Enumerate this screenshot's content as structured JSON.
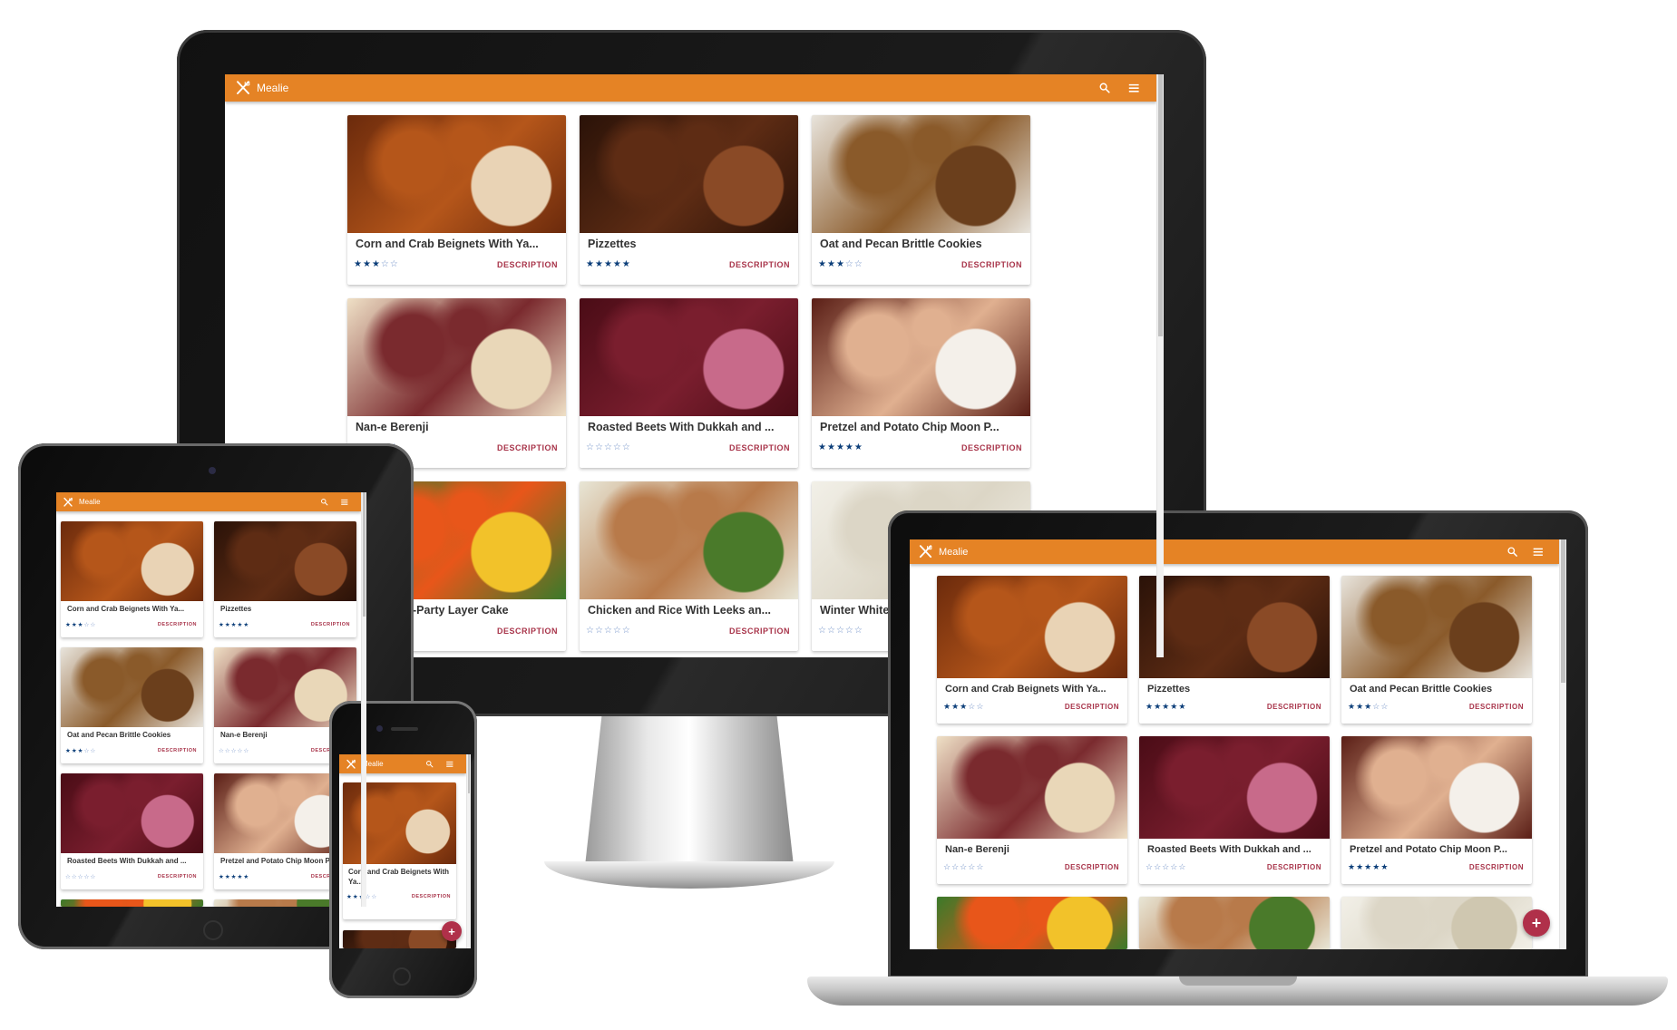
{
  "app": {
    "title": "Mealie",
    "icons": {
      "logo": "fork-knife-icon",
      "search": "search-icon",
      "menu": "hamburger-menu-icon",
      "add": "plus-icon"
    },
    "fab_label": "+",
    "colors": {
      "appbar": "#E58325",
      "description": "#a8344a",
      "star_filled": "#0d3f7a",
      "star_empty": "#6d8ec6",
      "fab": "#b0304a"
    }
  },
  "card_action_label": "DESCRIPTION",
  "recipes": [
    {
      "name": "Corn and Crab Beignets With Ya...",
      "rating": 3,
      "image_colors": [
        "#6b2a0c",
        "#b5561a",
        "#e9d3b5"
      ]
    },
    {
      "name": "Pizzettes",
      "rating": 5,
      "image_colors": [
        "#2a1208",
        "#5e2c14",
        "#8a4a26"
      ]
    },
    {
      "name": "Oat and Pecan Brittle Cookies",
      "rating": 3,
      "image_colors": [
        "#e8e4dc",
        "#8a5a2a",
        "#6b3f1c"
      ]
    },
    {
      "name": "Nan-e Berenji",
      "rating": 0,
      "image_colors": [
        "#efe0c6",
        "#7a2a2e",
        "#e9d7b8"
      ]
    },
    {
      "name": "Roasted Beets With Dukkah and ...",
      "rating": 0,
      "image_colors": [
        "#4a0c16",
        "#7a1e2e",
        "#c86a8a"
      ]
    },
    {
      "name": "Pretzel and Potato Chip Moon P...",
      "rating": 5,
      "image_colors": [
        "#5a1e16",
        "#e0b090",
        "#f4f0ea"
      ]
    },
    {
      "name": "-Party Layer Cake",
      "rating": 0,
      "image_colors": [
        "#3a7a2a",
        "#e8561a",
        "#f2c22a"
      ]
    },
    {
      "name": "Chicken and Rice With Leeks an...",
      "rating": 0,
      "image_colors": [
        "#e8e6d6",
        "#b87a4a",
        "#4a7a2a"
      ]
    },
    {
      "name": "Winter White",
      "rating": 0,
      "image_colors": [
        "#f2f0e8",
        "#dcd6c6",
        "#cfc7b0"
      ]
    }
  ]
}
